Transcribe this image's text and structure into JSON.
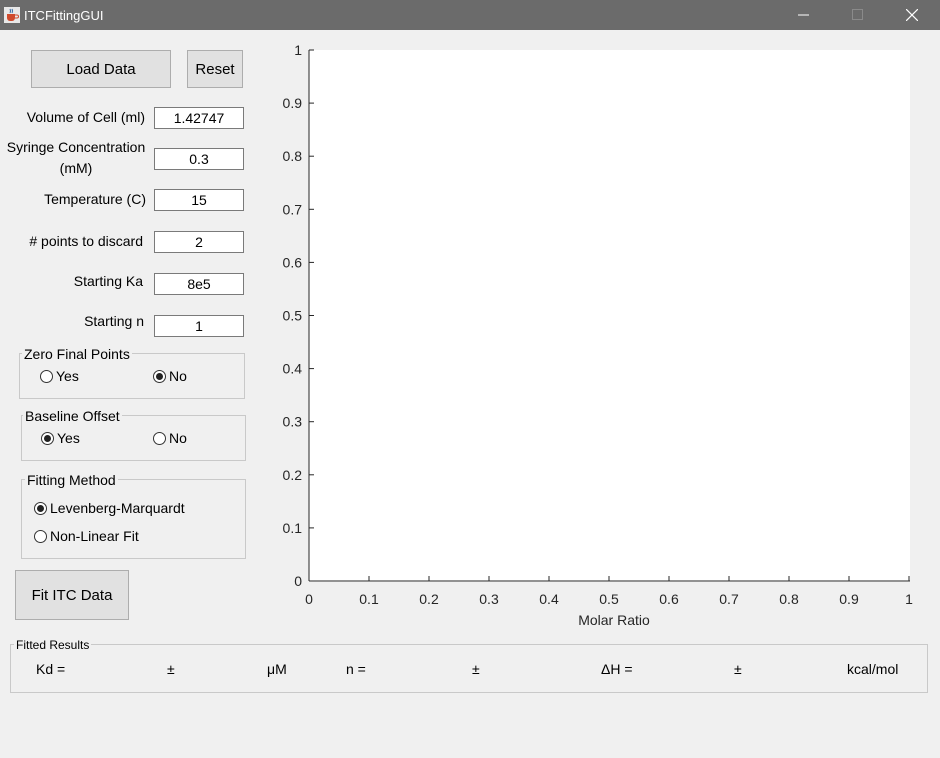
{
  "window": {
    "title": "ITCFittingGUI",
    "icons": [
      "java-cup-icon",
      "minimize-icon",
      "maximize-icon",
      "close-icon"
    ]
  },
  "controls": {
    "load_label": "Load Data",
    "reset_label": "Reset",
    "fit_label": "Fit ITC Data"
  },
  "params": {
    "volume_label": "Volume of Cell (ml)",
    "volume_value": "1.42747",
    "syringe_label": "Syringe Concentration (mM)",
    "syringe_value": "0.3",
    "temperature_label": "Temperature (C)",
    "temperature_value": "15",
    "discard_label": "# points to discard",
    "discard_value": "2",
    "ka_label": "Starting Ka",
    "ka_value": "8e5",
    "n_label": "Starting n",
    "n_value": "1"
  },
  "zero_final": {
    "title": "Zero Final Points",
    "yes": "Yes",
    "no": "No",
    "selected": "No"
  },
  "baseline": {
    "title": "Baseline Offset",
    "yes": "Yes",
    "no": "No",
    "selected": "Yes"
  },
  "fitting": {
    "title": "Fitting Method",
    "opt1": "Levenberg-Marquardt",
    "opt2": "Non-Linear Fit",
    "selected": "Levenberg-Marquardt"
  },
  "results": {
    "title": "Fitted Results",
    "kd": "Kd =",
    "pm1": "±",
    "um": "μM",
    "n": "n =",
    "pm2": "±",
    "dh": "ΔH =",
    "pm3": "±",
    "kcal": "kcal/mol"
  },
  "chart_data": {
    "type": "scatter",
    "title": "",
    "xlabel": "Molar Ratio",
    "ylabel": "",
    "xlim": [
      0,
      1
    ],
    "ylim": [
      0,
      1
    ],
    "x_ticks": [
      "0",
      "0.1",
      "0.2",
      "0.3",
      "0.4",
      "0.5",
      "0.6",
      "0.7",
      "0.8",
      "0.9",
      "1"
    ],
    "y_ticks": [
      "0",
      "0.1",
      "0.2",
      "0.3",
      "0.4",
      "0.5",
      "0.6",
      "0.7",
      "0.8",
      "0.9",
      "1"
    ],
    "series": [],
    "grid": false
  }
}
